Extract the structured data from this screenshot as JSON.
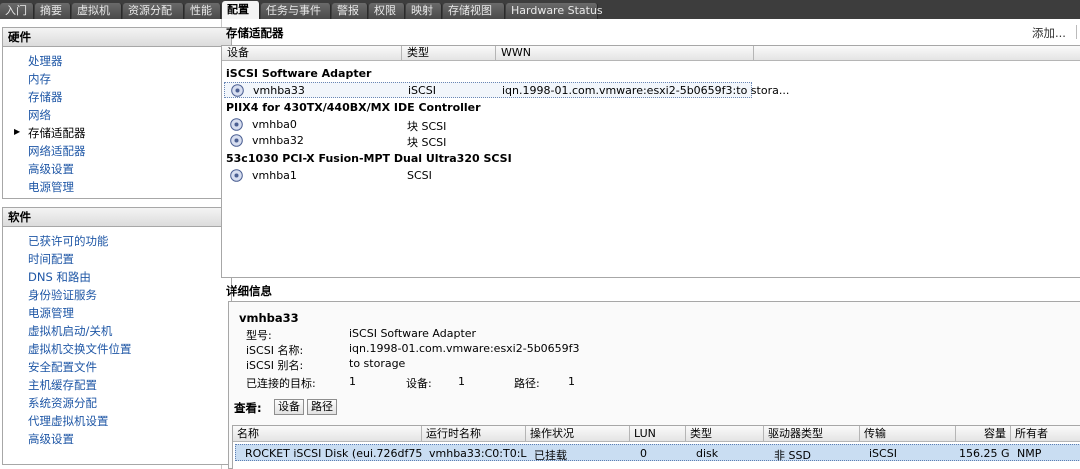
{
  "tabs": [
    "入门",
    "摘要",
    "虚拟机",
    "资源分配",
    "性能",
    "配置",
    "任务与事件",
    "警报",
    "权限",
    "映射",
    "存储视图",
    "Hardware Status"
  ],
  "active_tab": "配置",
  "hardware": {
    "title": "硬件",
    "items": [
      "处理器",
      "内存",
      "存储器",
      "网络",
      "存储适配器",
      "网络适配器",
      "高级设置",
      "电源管理"
    ],
    "current": "存储适配器"
  },
  "software": {
    "title": "软件",
    "items": [
      "已获许可的功能",
      "时间配置",
      "DNS 和路由",
      "身份验证服务",
      "电源管理",
      "虚拟机启动/关机",
      "虚拟机交换文件位置",
      "安全配置文件",
      "主机缓存配置",
      "系统资源分配",
      "代理虚拟机设置",
      "高级设置"
    ]
  },
  "adapters": {
    "title": "存储适配器",
    "add_label": "添加...",
    "columns": [
      "设备",
      "类型",
      "WWN"
    ],
    "groups": [
      {
        "name": "iSCSI Software Adapter",
        "rows": [
          {
            "device": "vmhba33",
            "type": "iSCSI",
            "wwn": "iqn.1998-01.com.vmware:esxi2-5b0659f3:to stora..."
          }
        ]
      },
      {
        "name": "PIIX4 for 430TX/440BX/MX IDE Controller",
        "rows": [
          {
            "device": "vmhba0",
            "type": "块 SCSI",
            "wwn": ""
          },
          {
            "device": "vmhba32",
            "type": "块 SCSI",
            "wwn": ""
          }
        ]
      },
      {
        "name": "53c1030 PCI-X Fusion-MPT Dual Ultra320 SCSI",
        "rows": [
          {
            "device": "vmhba1",
            "type": "SCSI",
            "wwn": ""
          }
        ]
      }
    ]
  },
  "details": {
    "title": "详细信息",
    "name": "vmhba33",
    "model_label": "型号:",
    "model": "iSCSI Software Adapter",
    "iscsi_name_label": "iSCSI 名称:",
    "iscsi_name": "iqn.1998-01.com.vmware:esxi2-5b0659f3",
    "alias_label": "iSCSI 别名:",
    "alias": "to storage",
    "targets_label": "已连接的目标:",
    "targets": "1",
    "devices_label": "设备:",
    "devices": "1",
    "paths_label": "路径:",
    "paths": "1",
    "view_label": "查看:",
    "view_buttons": [
      "设备",
      "路径"
    ]
  },
  "lun_table": {
    "columns": [
      "名称",
      "运行时名称",
      "操作状况",
      "LUN",
      "类型",
      "驱动器类型",
      "传输",
      "容量",
      "所有者"
    ],
    "rows": [
      {
        "name": "ROCKET iSCSI Disk (eui.726df75d6...",
        "runtime": "vmhba33:C0:T0:L0",
        "status": "已挂载",
        "lun": "0",
        "type": "disk",
        "drive_type": "非 SSD",
        "transport": "iSCSI",
        "capacity": "156.25 G",
        "owner": "NMP"
      }
    ]
  }
}
